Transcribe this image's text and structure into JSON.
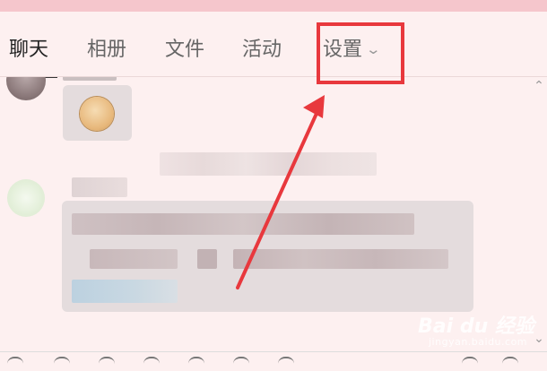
{
  "tabs": [
    {
      "label": "聊天",
      "active": true
    },
    {
      "label": "相册",
      "active": false
    },
    {
      "label": "文件",
      "active": false
    },
    {
      "label": "活动",
      "active": false
    },
    {
      "label": "设置",
      "active": false,
      "has_dropdown": true
    }
  ],
  "colors": {
    "accent_highlight": "#e8383d",
    "top_bar": "#f5c6cc",
    "background": "#fdf0f0"
  },
  "watermark": {
    "brand": "Bai du 经验",
    "url": "jingyan.baidu.com"
  },
  "icons": [
    "chevron-down-icon",
    "scroll-up-icon",
    "scroll-down-icon",
    "arrow-annotation",
    "highlight-box"
  ]
}
